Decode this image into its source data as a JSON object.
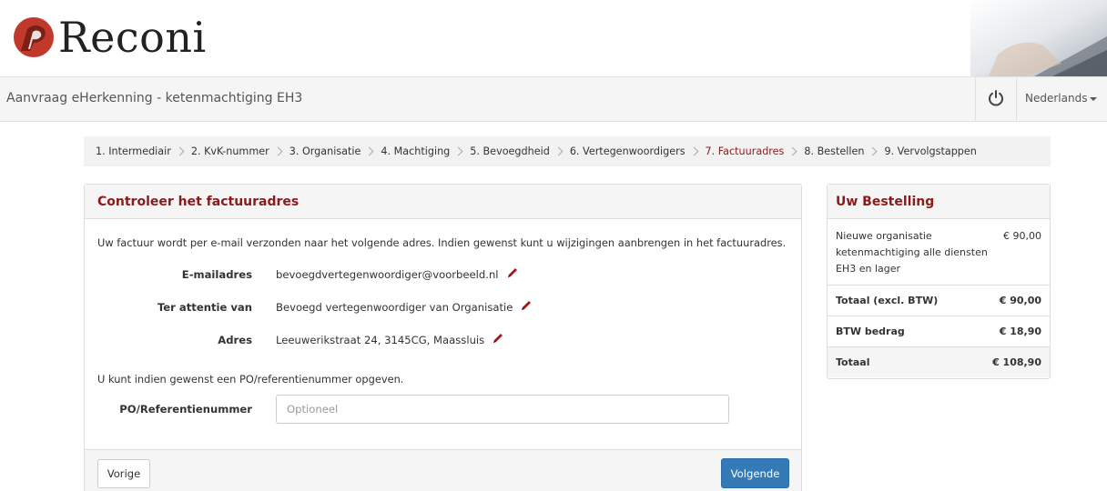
{
  "brand": {
    "name": "Reconi"
  },
  "navbar": {
    "title": "Aanvraag eHerkenning - ketenmachtiging EH3",
    "language": "Nederlands"
  },
  "steps": [
    {
      "label": "1. Intermediair",
      "active": false
    },
    {
      "label": "2. KvK-nummer",
      "active": false
    },
    {
      "label": "3. Organisatie",
      "active": false
    },
    {
      "label": "4. Machtiging",
      "active": false
    },
    {
      "label": "5. Bevoegdheid",
      "active": false
    },
    {
      "label": "6. Vertegenwoordigers",
      "active": false
    },
    {
      "label": "7. Factuuradres",
      "active": true
    },
    {
      "label": "8. Bestellen",
      "active": false
    },
    {
      "label": "9. Vervolgstappen",
      "active": false
    }
  ],
  "form": {
    "heading": "Controleer het factuuradres",
    "intro": "Uw factuur wordt per e-mail verzonden naar het volgende adres. Indien gewenst kunt u wijzigingen aanbrengen in het factuuradres.",
    "fields": [
      {
        "label": "E-mailadres",
        "value": "bevoegdvertegenwoordiger@voorbeeld.nl"
      },
      {
        "label": "Ter attentie van",
        "value": "Bevoegd vertegenwoordiger van Organisatie"
      },
      {
        "label": "Adres",
        "value": "Leeuwerikstraat 24, 3145CG, Maassluis"
      }
    ],
    "po_hint": "U kunt indien gewenst een PO/referentienummer opgeven.",
    "po_label": "PO/Referentienummer",
    "po_placeholder": "Optioneel",
    "po_value": "",
    "prev_label": "Vorige",
    "next_label": "Volgende"
  },
  "order": {
    "heading": "Uw Bestelling",
    "item_label": "Nieuwe organisatie ketenmachtiging alle diensten EH3 en lager",
    "item_value": "€ 90,00",
    "subtotal_label": "Totaal (excl. BTW)",
    "subtotal_value": "€ 90,00",
    "vat_label": "BTW bedrag",
    "vat_value": "€ 18,90",
    "total_label": "Totaal",
    "total_value": "€ 108,90"
  },
  "colors": {
    "brand": "#8b1a1a",
    "primary_button": "#337ab7",
    "logo_mark": "#c0392b"
  },
  "icons": [
    "reconi-logo-icon",
    "power-icon",
    "chevron-right-icon",
    "pencil-icon",
    "caret-down-icon"
  ]
}
